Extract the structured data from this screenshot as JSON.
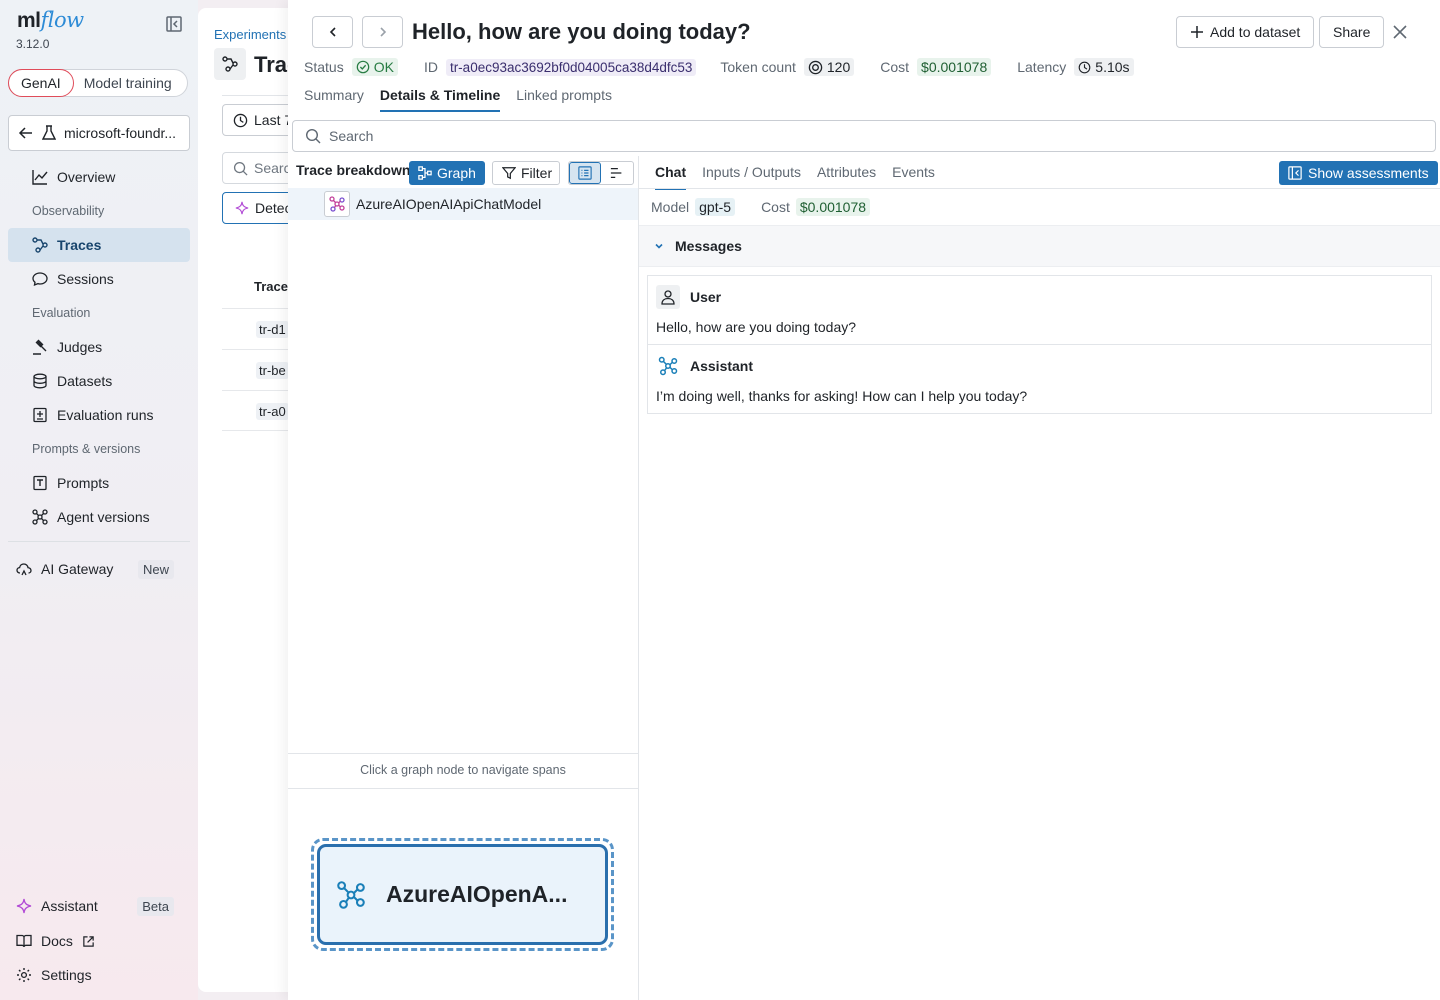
{
  "app": {
    "logo_main": "ml",
    "logo_accent": "flow",
    "version": "3.12.0"
  },
  "sidebar": {
    "mode_active": "GenAI",
    "mode_other": "Model training",
    "experiment": "microsoft-foundr...",
    "overview": "Overview",
    "section_observability": "Observability",
    "traces": "Traces",
    "sessions": "Sessions",
    "section_evaluation": "Evaluation",
    "judges": "Judges",
    "datasets": "Datasets",
    "evaluation_runs": "Evaluation runs",
    "section_prompts": "Prompts & versions",
    "prompts": "Prompts",
    "agent_versions": "Agent versions",
    "ai_gateway": "AI Gateway",
    "ai_gateway_badge": "New",
    "assistant": "Assistant",
    "assistant_badge": "Beta",
    "docs": "Docs",
    "settings": "Settings"
  },
  "background": {
    "breadcrumb": "Experiments",
    "title": "Trac",
    "time_btn": "Last 7",
    "search": "Searc",
    "detect_btn": "Detec",
    "col_header": "Trace",
    "rows": [
      "tr-d1",
      "tr-be",
      "tr-a0"
    ]
  },
  "drawer": {
    "title": "Hello, how are you doing today?",
    "add_to_dataset": "Add to dataset",
    "share": "Share",
    "status_label": "Status",
    "status_value": "OK",
    "id_label": "ID",
    "id_value": "tr-a0ec93ac3692bf0d04005ca38d4dfc53",
    "token_label": "Token count",
    "token_value": "120",
    "cost_label": "Cost",
    "cost_value": "$0.001078",
    "latency_label": "Latency",
    "latency_value": "5.10s",
    "tabs": [
      "Summary",
      "Details & Timeline",
      "Linked prompts"
    ],
    "search_placeholder": "Search"
  },
  "breakdown": {
    "title": "Trace breakdown",
    "graph_btn": "Graph",
    "filter_btn": "Filter",
    "span_name": "AzureAIOpenAIApiChatModel",
    "graph_hint": "Click a graph node to navigate spans",
    "graph_node_label": "AzureAIOpenA..."
  },
  "detail": {
    "tabs": [
      "Chat",
      "Inputs / Outputs",
      "Attributes",
      "Events"
    ],
    "show_assessments": "Show assessments",
    "model_label": "Model",
    "model_value": "gpt-5",
    "cost_label": "Cost",
    "cost_value": "$0.001078",
    "messages_header": "Messages",
    "messages": [
      {
        "role": "User",
        "text": "Hello, how are you doing today?"
      },
      {
        "role": "Assistant",
        "text": "I’m doing well, thanks for asking! How can I help you today?"
      }
    ]
  },
  "colors": {
    "accent": "#2272b4",
    "ok": "#277c43",
    "active_nav_bg": "#d5e2ee"
  }
}
